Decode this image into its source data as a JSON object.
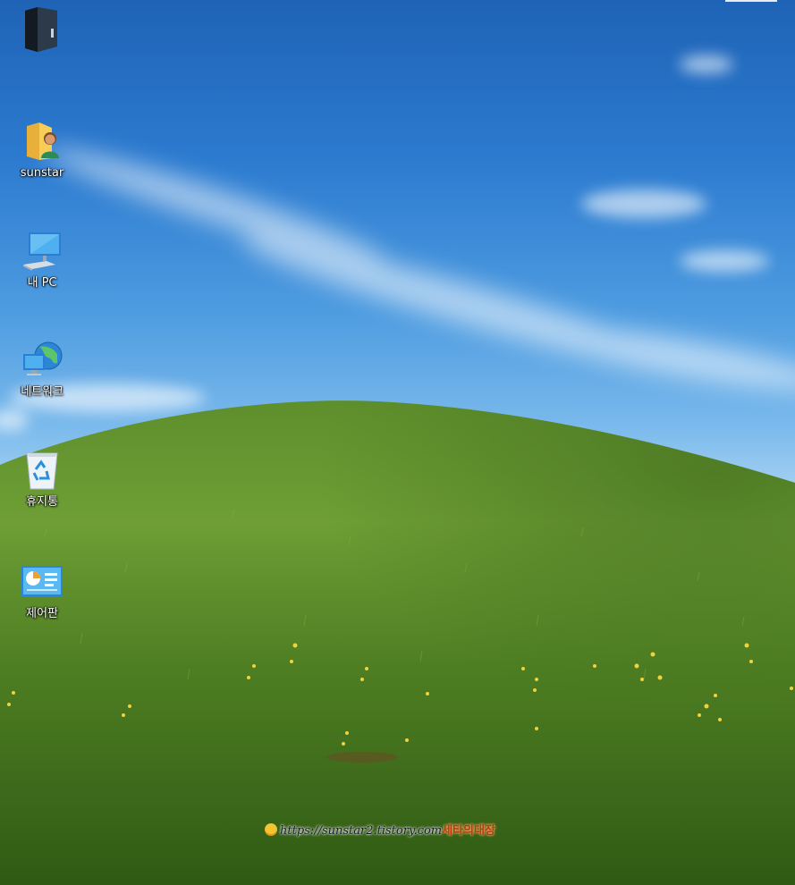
{
  "desktop": {
    "icons": [
      {
        "label": "",
        "icon": "dark-folder-icon"
      },
      {
        "label": "sunstar",
        "icon": "user-folder-icon"
      },
      {
        "label": "내 PC",
        "icon": "computer-icon"
      },
      {
        "label": "네트워크",
        "icon": "network-icon"
      },
      {
        "label": "휴지통",
        "icon": "recycle-bin-icon"
      },
      {
        "label": "제어판",
        "icon": "control-panel-icon"
      }
    ]
  },
  "watermark": {
    "url": "https://sunstar2.tistory.com",
    "tag": "세타의대장"
  },
  "colors": {
    "sky_top": "#1f63b6",
    "sky_bottom": "#c7e4f7",
    "hill_light": "#6e9e35",
    "hill_dark": "#2f5a14"
  }
}
